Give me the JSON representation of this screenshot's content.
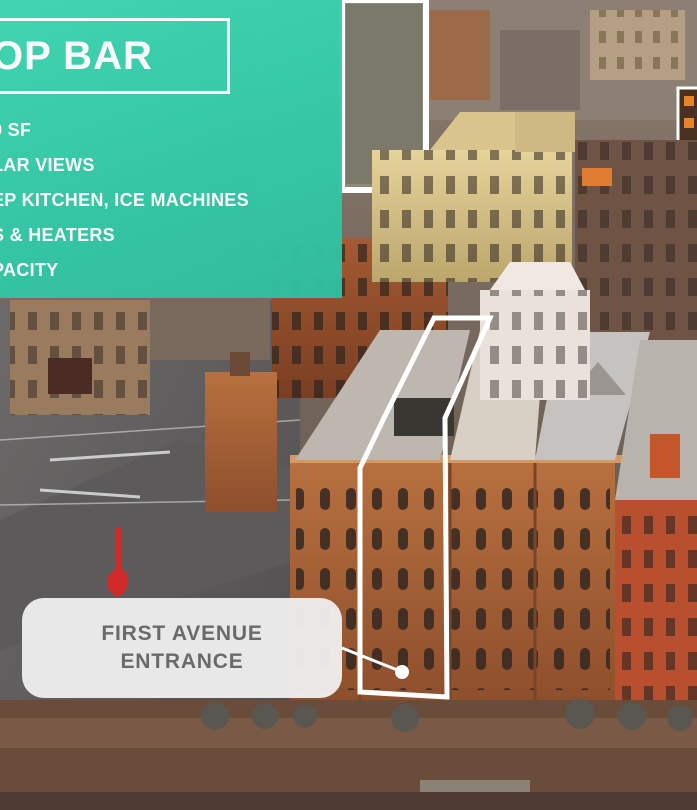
{
  "panel": {
    "title": "OP BAR",
    "features": [
      "0 SF",
      "LAR VIEWS",
      "EP KITCHEN, ICE MACHINES",
      "S & HEATERS",
      "PACITY"
    ]
  },
  "callout": {
    "line1": "FIRST AVENUE",
    "line2": "ENTRANCE"
  },
  "colors": {
    "panel_accent": "#3fd8b4",
    "callout_bg": "#f1f1f1",
    "callout_text": "#6a6a6a",
    "outline": "#ffffff"
  }
}
